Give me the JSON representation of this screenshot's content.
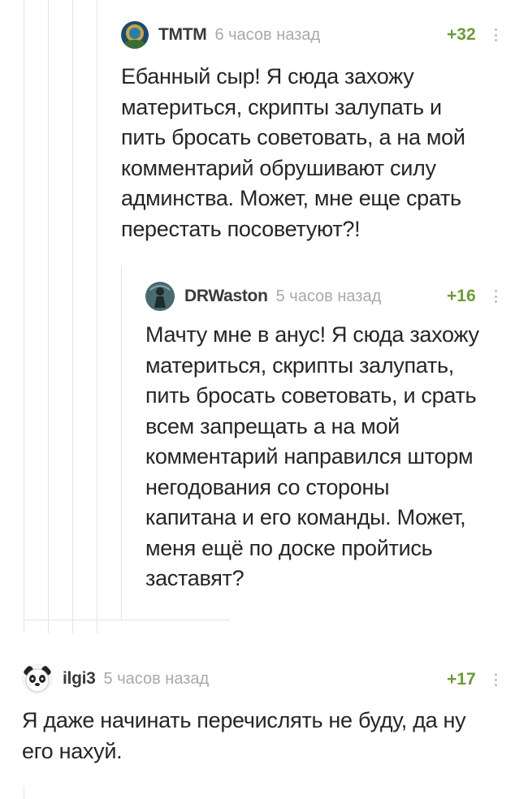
{
  "comments": [
    {
      "author": "TMTM",
      "time": "6 часов назад",
      "rating": "+32",
      "avatar": "diver-avatar",
      "lines": [
        "Ебанный сыр! Я сюда захожу",
        "материться, скрипты залупать и",
        "пить бросать советовать, а на мой",
        "комментарий обрушивают силу",
        "админства. Может, мне еще срать",
        "перестать посоветуют?!"
      ]
    },
    {
      "author": "DRWaston",
      "time": "5 часов назад",
      "rating": "+16",
      "avatar": "figure-avatar",
      "lines": [
        "Мачту мне в анус! Я сюда захожу",
        "материться, скрипты залупать,",
        "пить бросать советовать, и срать",
        "всем запрещать а на мой",
        "комментарий направился шторм",
        "негодования со стороны",
        "капитана и его команды. Может,",
        "меня ещё по доске пройтись",
        "заставят?"
      ]
    },
    {
      "author": "ilgi3",
      "time": "5 часов назад",
      "rating": "+17",
      "avatar": "panda-avatar",
      "lines": [
        "Я даже начинать перечислять не буду, да ну",
        "его нахуй."
      ]
    }
  ],
  "colors": {
    "rating_positive": "#6d9a3a",
    "thread_line": "#e4e4e4",
    "time_text": "#a9a9a9"
  }
}
